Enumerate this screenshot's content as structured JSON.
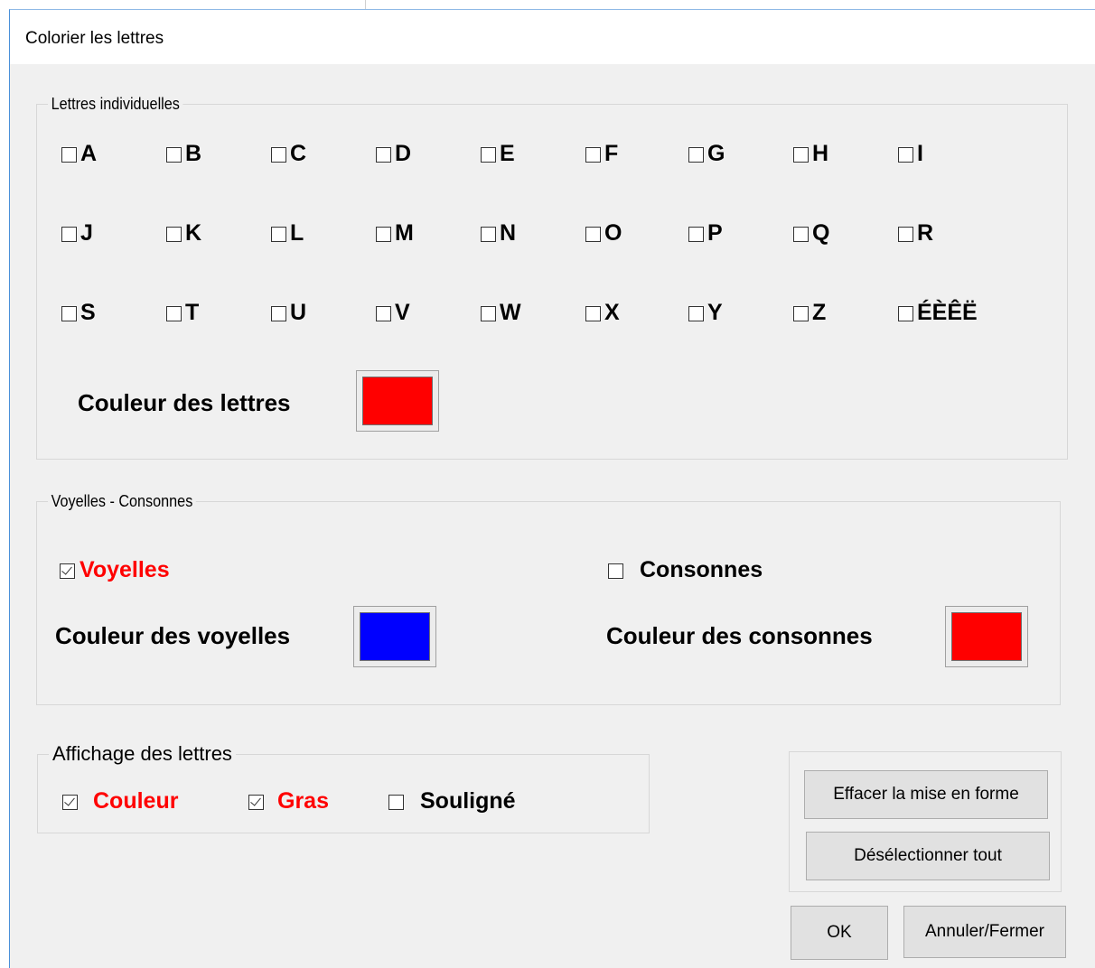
{
  "window": {
    "title": "Colorier les lettres"
  },
  "individual": {
    "legend": "Lettres individuelles",
    "rows": [
      [
        {
          "label": "A",
          "checked": false
        },
        {
          "label": "B",
          "checked": false
        },
        {
          "label": "C",
          "checked": false
        },
        {
          "label": "D",
          "checked": false
        },
        {
          "label": "E",
          "checked": false
        },
        {
          "label": "F",
          "checked": false
        },
        {
          "label": "G",
          "checked": false
        },
        {
          "label": "H",
          "checked": false
        },
        {
          "label": "I",
          "checked": false
        }
      ],
      [
        {
          "label": "J",
          "checked": false
        },
        {
          "label": "K",
          "checked": false
        },
        {
          "label": "L",
          "checked": false
        },
        {
          "label": "M",
          "checked": false
        },
        {
          "label": "N",
          "checked": false
        },
        {
          "label": "O",
          "checked": false
        },
        {
          "label": "P",
          "checked": false
        },
        {
          "label": "Q",
          "checked": false
        },
        {
          "label": "R",
          "checked": false
        }
      ],
      [
        {
          "label": "S",
          "checked": false
        },
        {
          "label": "T",
          "checked": false
        },
        {
          "label": "U",
          "checked": false
        },
        {
          "label": "V",
          "checked": false
        },
        {
          "label": "W",
          "checked": false
        },
        {
          "label": "X",
          "checked": false
        },
        {
          "label": "Y",
          "checked": false
        },
        {
          "label": "Z",
          "checked": false
        },
        {
          "label": "ÉÈÊË",
          "checked": false
        }
      ]
    ],
    "color_label": "Couleur des lettres",
    "color": "#ff0000"
  },
  "vc": {
    "legend": "Voyelles - Consonnes",
    "vowels_label": "Voyelles",
    "vowels_checked": true,
    "consonants_label": "Consonnes",
    "consonants_checked": false,
    "vowel_color_label": "Couleur des voyelles",
    "vowel_color": "#0000ff",
    "consonant_color_label": "Couleur des consonnes",
    "consonant_color": "#ff0000"
  },
  "display": {
    "legend": "Affichage des lettres",
    "couleur_label": "Couleur",
    "couleur_checked": true,
    "gras_label": "Gras",
    "gras_checked": true,
    "souligne_label": "Souligné",
    "souligne_checked": false
  },
  "buttons": {
    "clear_format": "Effacer la mise en forme",
    "deselect_all": "Désélectionner tout",
    "ok": "OK",
    "cancel": "Annuler/Fermer"
  },
  "colors": {
    "checked_label": "#ff0000",
    "dialog_bg": "#f0f0f0"
  }
}
